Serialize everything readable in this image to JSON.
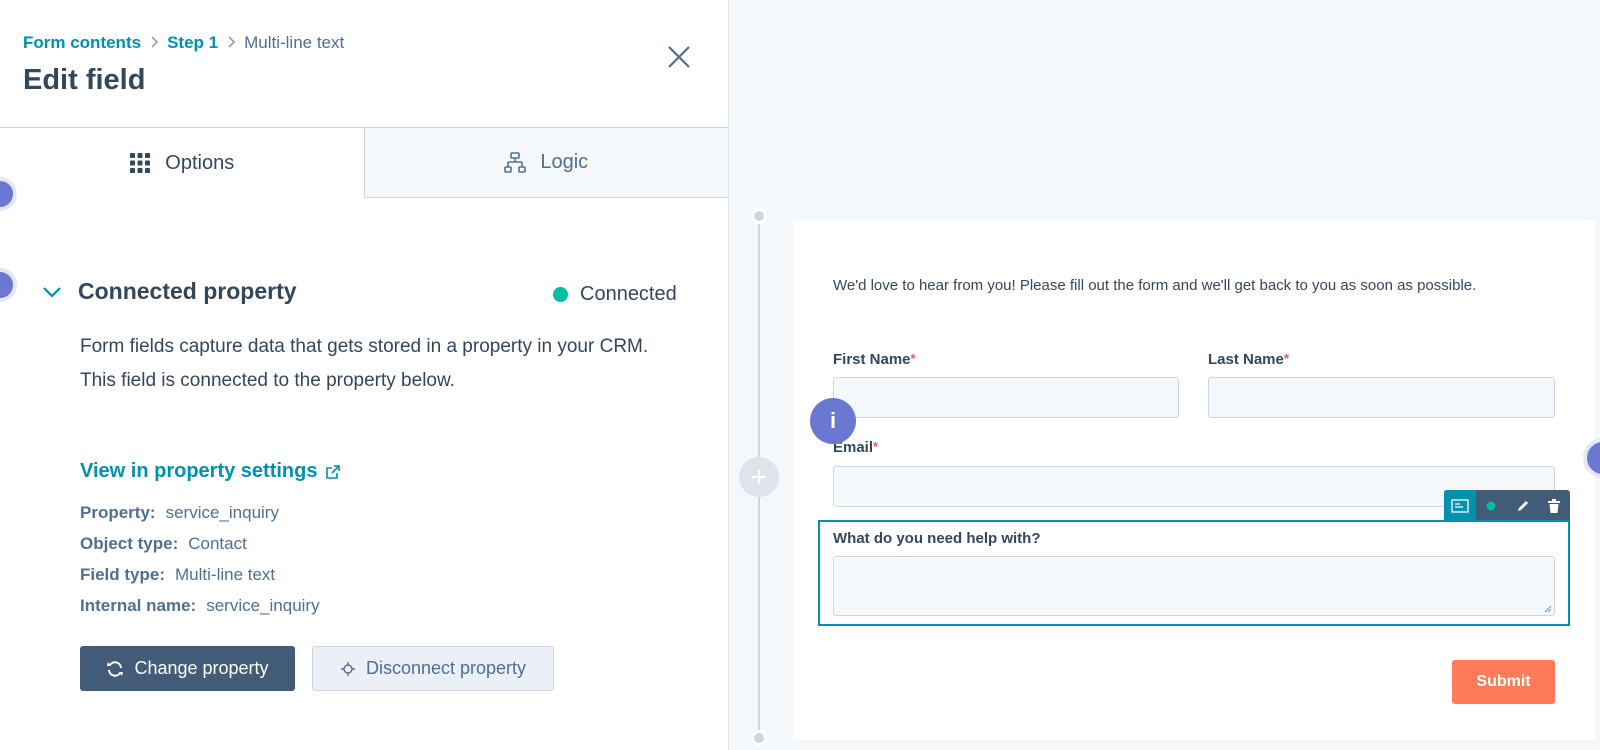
{
  "header": {
    "breadcrumb": [
      "Form contents",
      "Step 1",
      "Multi-line text"
    ],
    "title": "Edit field"
  },
  "tabs": [
    {
      "label": "Options",
      "icon": "grid-icon",
      "active": true
    },
    {
      "label": "Logic",
      "icon": "flow-icon",
      "active": false
    }
  ],
  "section": {
    "title": "Connected property",
    "status": "Connected",
    "status_color": "#00bda5",
    "description_1": "Form fields capture data that gets stored in a property in your CRM.",
    "description_2": "This field is connected to the property below.",
    "link": "View in property settings"
  },
  "properties": [
    {
      "key": "Property:",
      "value": "service_inquiry"
    },
    {
      "key": "Object type:",
      "value": "Contact"
    },
    {
      "key": "Field type:",
      "value": "Multi-line text"
    },
    {
      "key": "Internal name:",
      "value": "service_inquiry"
    }
  ],
  "buttons": {
    "change": "Change property",
    "disconnect": "Disconnect property"
  },
  "form": {
    "intro": "We'd love to hear from you! Please fill out the form and we'll get back to you as soon as possible.",
    "first_name": "First Name",
    "last_name": "Last Name",
    "email": "Email",
    "required_mark": "*",
    "help": "What do you need help with?",
    "submit": "Submit",
    "submit_color": "#ff7a59"
  },
  "info_bubble": "i"
}
